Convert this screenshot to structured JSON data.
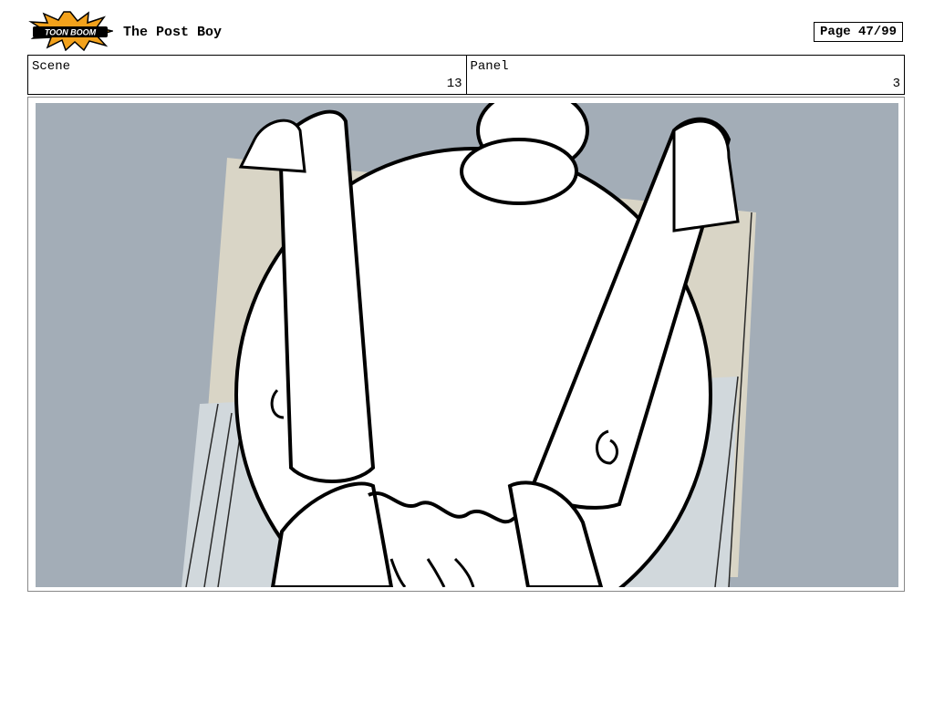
{
  "header": {
    "logo_text": "TOON BOOM",
    "title": "The Post Boy",
    "page": "Page 47/99"
  },
  "info": {
    "scene_label": "Scene",
    "scene_value": "13",
    "panel_label": "Panel",
    "panel_value": "3"
  },
  "colors": {
    "background_gray": "#a3adb7",
    "chair_beige": "#d9d5c6",
    "chair_gray": "#d1d8dc",
    "logo_orange": "#f3a21c",
    "logo_black": "#000000"
  }
}
